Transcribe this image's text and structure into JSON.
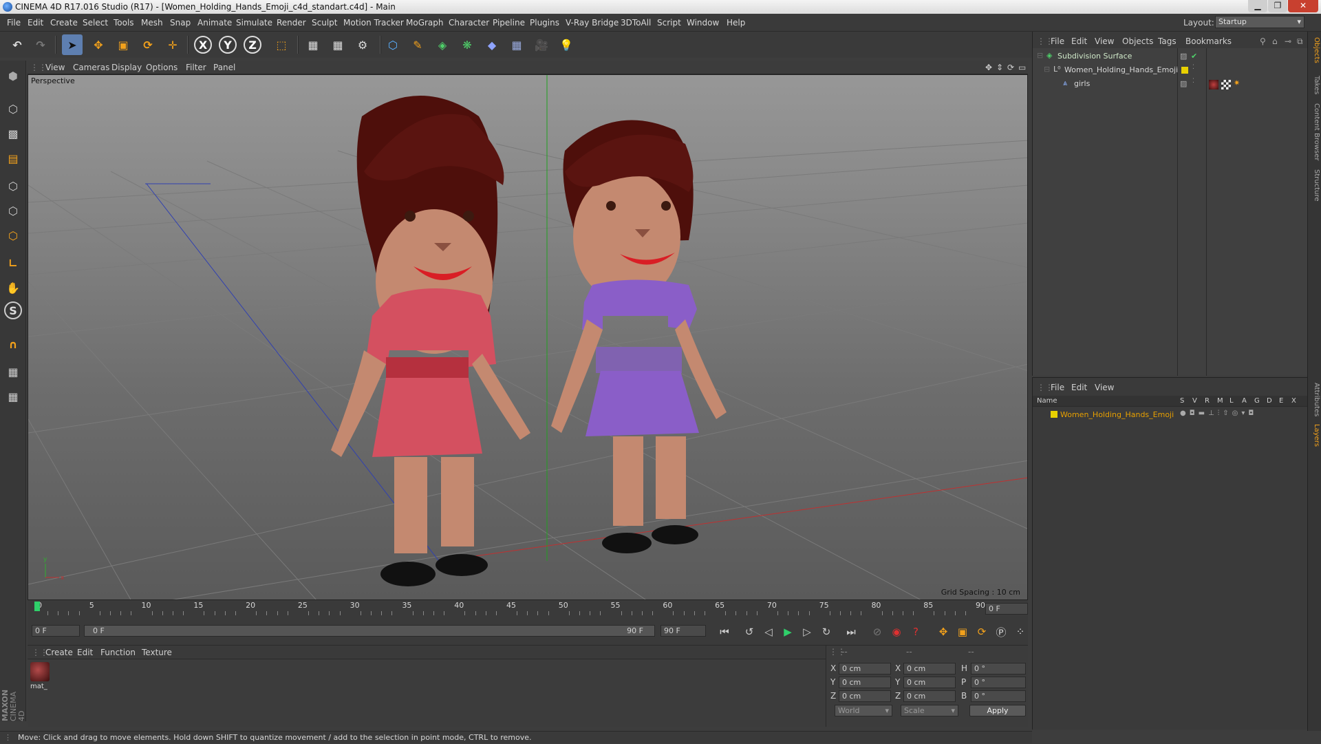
{
  "window": {
    "title": "CINEMA 4D R17.016 Studio (R17) - [Women_Holding_Hands_Emoji_c4d_standart.c4d] - Main"
  },
  "menubar": {
    "items": [
      "File",
      "Edit",
      "Create",
      "Select",
      "Tools",
      "Mesh",
      "Snap",
      "Animate",
      "Simulate",
      "Render",
      "Sculpt",
      "Motion Tracker",
      "MoGraph",
      "Character",
      "Pipeline",
      "Plugins",
      "V-Ray Bridge",
      "3DToAll",
      "Script",
      "Window",
      "Help"
    ],
    "layout_label": "Layout:",
    "layout_value": "Startup"
  },
  "toolbar": {
    "icons": [
      "undo-icon",
      "redo-icon",
      "select-arrow-icon",
      "move-icon",
      "scale-icon",
      "rotate-icon",
      "live-select-icon",
      "x-axis-icon",
      "y-axis-icon",
      "z-axis-icon",
      "coordinate-system-icon",
      "render-view-icon",
      "render-picture-viewer-icon",
      "render-settings-icon",
      "cube-icon",
      "pen-spline-icon",
      "subdivision-icon",
      "mograph-cloner-icon",
      "deformer-icon",
      "floor-icon",
      "camera-icon",
      "light-icon"
    ],
    "axis_labels": [
      "X",
      "Y",
      "Z"
    ]
  },
  "viewport": {
    "menu": [
      "View",
      "Cameras",
      "Display",
      "Options",
      "Filter",
      "Panel"
    ],
    "label": "Perspective",
    "grid_spacing": "Grid Spacing : 10 cm"
  },
  "timeline": {
    "ticks": [
      "0",
      "5",
      "10",
      "15",
      "20",
      "25",
      "30",
      "35",
      "40",
      "45",
      "50",
      "55",
      "60",
      "65",
      "70",
      "75",
      "80",
      "85",
      "90"
    ],
    "current_frame": "0 F"
  },
  "transport": {
    "start_field": "0 F",
    "range_start": "0 F",
    "range_end": "90 F",
    "end_field": "90 F"
  },
  "materials": {
    "menu": [
      "Create",
      "Edit",
      "Function",
      "Texture"
    ],
    "items": [
      {
        "name": "mat_"
      }
    ]
  },
  "coordinates": {
    "header": [
      "--",
      "--",
      "--"
    ],
    "rows": [
      {
        "a": "X",
        "v1": "0 cm",
        "b": "X",
        "v2": "0 cm",
        "c": "H",
        "v3": "0 °"
      },
      {
        "a": "Y",
        "v1": "0 cm",
        "b": "Y",
        "v2": "0 cm",
        "c": "P",
        "v3": "0 °"
      },
      {
        "a": "Z",
        "v1": "0 cm",
        "b": "Z",
        "v2": "0 cm",
        "c": "B",
        "v3": "0 °"
      }
    ],
    "mode": "World",
    "transform": "Scale",
    "apply": "Apply"
  },
  "objects": {
    "menu": [
      "File",
      "Edit",
      "View",
      "Objects",
      "Tags",
      "Bookmarks"
    ],
    "rows": [
      {
        "name": "Subdivision Surface",
        "color": "#7dd36a"
      },
      {
        "name": "Women_Holding_Hands_Emoji",
        "color": "#d8d8d8"
      },
      {
        "name": "girls",
        "color": "#d8d8d8"
      }
    ]
  },
  "layers": {
    "menu": [
      "File",
      "Edit",
      "View"
    ],
    "columns": [
      "Name",
      "S",
      "V",
      "R",
      "M",
      "L",
      "A",
      "G",
      "D",
      "E",
      "X"
    ],
    "rows": [
      {
        "name": "Women_Holding_Hands_Emoji",
        "color": "#e8c000"
      }
    ]
  },
  "right_tabs": [
    "Objects",
    "Takes",
    "Content Browser",
    "Structure",
    "Attributes",
    "Layers"
  ],
  "status": "Move: Click and drag to move elements. Hold down SHIFT to quantize movement / add to the selection in point mode, CTRL to remove.",
  "branding": {
    "maxon": "MAXON",
    "product": "CINEMA 4D"
  },
  "colors": {
    "accent": "#5e7fb0",
    "selected_layer": "#e8a000",
    "x_axis": "#c03030",
    "y_axis": "#30b030",
    "z_axis": "#3050c0"
  }
}
